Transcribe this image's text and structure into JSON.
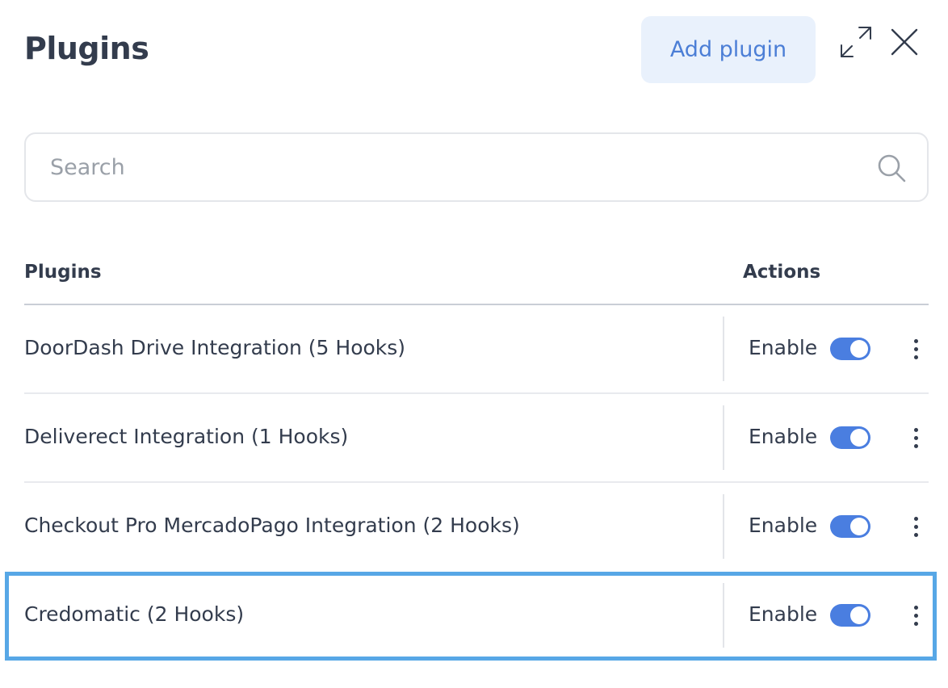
{
  "header": {
    "title": "Plugins",
    "add_plugin_label": "Add plugin"
  },
  "search": {
    "placeholder": "Search",
    "value": ""
  },
  "table": {
    "columns": [
      "Plugins",
      "Actions"
    ],
    "rows": [
      {
        "name": "DoorDash Drive Integration (5 Hooks)",
        "enable_label": "Enable",
        "enabled": true
      },
      {
        "name": "Deliverect Integration (1 Hooks)",
        "enable_label": "Enable",
        "enabled": true
      },
      {
        "name": "Checkout Pro MercadoPago Integration (2 Hooks)",
        "enable_label": "Enable",
        "enabled": true
      },
      {
        "name": "Credomatic (2 Hooks)",
        "enable_label": "Enable",
        "enabled": true,
        "highlighted": true
      }
    ]
  },
  "icons": {
    "expand": "expand-icon",
    "close": "close-icon",
    "search": "search-icon",
    "more": "more-vertical-icon"
  },
  "colors": {
    "accent": "#4a7ee0",
    "add_button_bg": "#e9f1fc",
    "add_button_text": "#4b7ed6",
    "highlight_border": "#57a7e6",
    "text": "#333c4d"
  }
}
